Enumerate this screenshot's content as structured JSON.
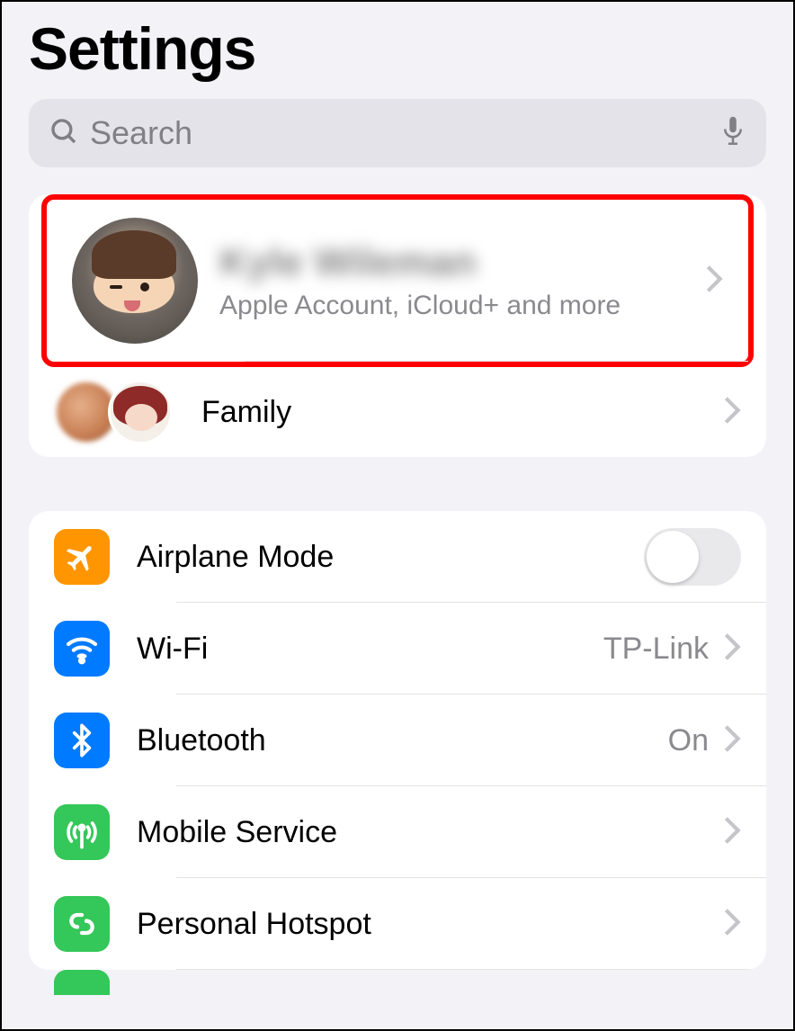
{
  "header": {
    "title": "Settings"
  },
  "search": {
    "placeholder": "Search"
  },
  "account": {
    "name": "Kyle Wileman",
    "subtitle": "Apple Account, iCloud+ and more"
  },
  "family": {
    "label": "Family"
  },
  "settings": {
    "airplane": {
      "label": "Airplane Mode",
      "on": false
    },
    "wifi": {
      "label": "Wi-Fi",
      "value": "TP-Link"
    },
    "bluetooth": {
      "label": "Bluetooth",
      "value": "On"
    },
    "mobile": {
      "label": "Mobile Service"
    },
    "hotspot": {
      "label": "Personal Hotspot"
    }
  },
  "colors": {
    "orange": "#ff9500",
    "blue": "#007aff",
    "green": "#34c759",
    "highlight": "#ff0000"
  }
}
